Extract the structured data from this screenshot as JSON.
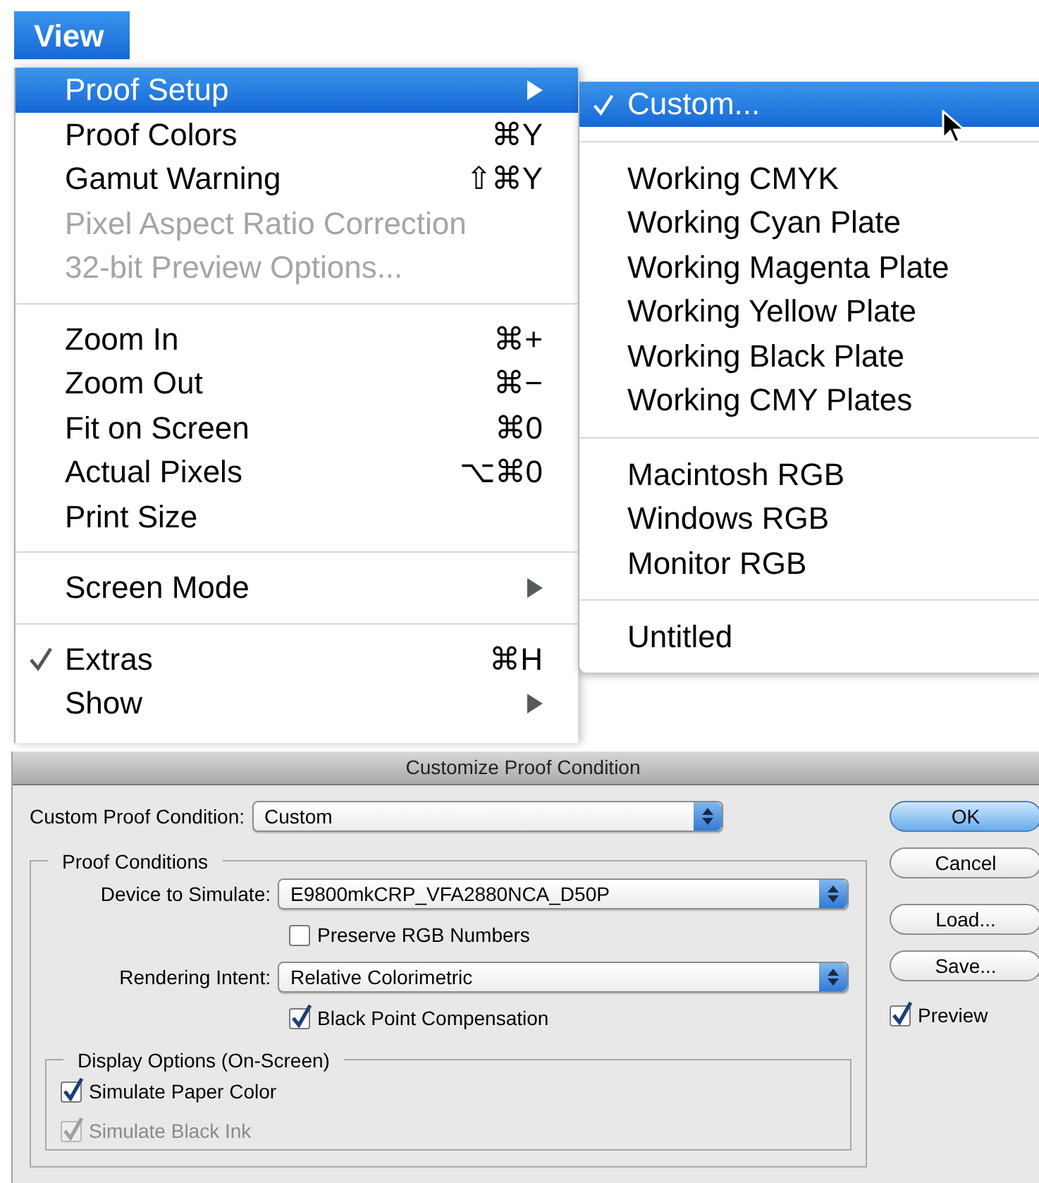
{
  "menu_bar": {
    "title": "View",
    "selected": true
  },
  "menu": {
    "groups": [
      [
        {
          "label": "Proof Setup",
          "submenu": true,
          "disabled": false,
          "checked": false,
          "selected": true
        },
        {
          "label": "Proof Colors",
          "shortcut": "⌘Y",
          "submenu": false,
          "disabled": false,
          "checked": false,
          "selected": false
        },
        {
          "label": "Gamut Warning",
          "shortcut": "⇧⌘Y",
          "submenu": false,
          "disabled": false,
          "checked": false,
          "selected": false
        },
        {
          "label": "Pixel Aspect Ratio Correction",
          "submenu": false,
          "disabled": true,
          "checked": false,
          "selected": false
        },
        {
          "label": "32-bit Preview Options...",
          "submenu": false,
          "disabled": true,
          "checked": false,
          "selected": false
        }
      ],
      [
        {
          "label": "Zoom In",
          "shortcut": "⌘+",
          "submenu": false,
          "disabled": false,
          "checked": false,
          "selected": false
        },
        {
          "label": "Zoom Out",
          "shortcut": "⌘−",
          "submenu": false,
          "disabled": false,
          "checked": false,
          "selected": false
        },
        {
          "label": "Fit on Screen",
          "shortcut": "⌘0",
          "submenu": false,
          "disabled": false,
          "checked": false,
          "selected": false
        },
        {
          "label": "Actual Pixels",
          "shortcut": "⌥⌘0",
          "submenu": false,
          "disabled": false,
          "checked": false,
          "selected": false
        },
        {
          "label": "Print Size",
          "submenu": false,
          "disabled": false,
          "checked": false,
          "selected": false
        }
      ],
      [
        {
          "label": "Screen Mode",
          "submenu": true,
          "disabled": false,
          "checked": false,
          "selected": false
        }
      ],
      [
        {
          "label": "Extras",
          "shortcut": "⌘H",
          "submenu": false,
          "disabled": false,
          "checked": true,
          "selected": false
        },
        {
          "label": "Show",
          "submenu": true,
          "disabled": false,
          "checked": false,
          "selected": false
        }
      ]
    ]
  },
  "submenu": {
    "groups": [
      [
        {
          "label": "Custom...",
          "checked": true,
          "selected": true
        }
      ],
      [
        {
          "label": "Working CMYK",
          "checked": false,
          "selected": false
        },
        {
          "label": "Working Cyan Plate",
          "checked": false,
          "selected": false
        },
        {
          "label": "Working Magenta Plate",
          "checked": false,
          "selected": false
        },
        {
          "label": "Working Yellow Plate",
          "checked": false,
          "selected": false
        },
        {
          "label": "Working Black Plate",
          "checked": false,
          "selected": false
        },
        {
          "label": "Working CMY Plates",
          "checked": false,
          "selected": false
        }
      ],
      [
        {
          "label": "Macintosh RGB",
          "checked": false,
          "selected": false
        },
        {
          "label": "Windows RGB",
          "checked": false,
          "selected": false
        },
        {
          "label": "Monitor RGB",
          "checked": false,
          "selected": false
        }
      ],
      [
        {
          "label": "Untitled",
          "checked": false,
          "selected": false
        }
      ]
    ]
  },
  "dialog": {
    "title": "Customize Proof Condition",
    "custom_condition": {
      "label": "Custom Proof Condition:",
      "value": "Custom"
    },
    "proof_conditions": {
      "legend": "Proof Conditions",
      "rows": [
        {
          "kind": "select",
          "label": "Device to Simulate:",
          "value": "E9800mkCRP_VFA2880NCA_D50P"
        },
        {
          "kind": "checkbox",
          "label": "Preserve RGB Numbers",
          "checked": false,
          "disabled": false
        },
        {
          "kind": "select",
          "label": "Rendering Intent:",
          "value": "Relative Colorimetric"
        },
        {
          "kind": "checkbox",
          "label": "Black Point Compensation",
          "checked": true,
          "disabled": false
        }
      ]
    },
    "display_options": {
      "legend": "Display Options (On-Screen)",
      "checkboxes": [
        {
          "label": "Simulate Paper Color",
          "checked": true,
          "disabled": false
        },
        {
          "label": "Simulate Black Ink",
          "checked": true,
          "disabled": true
        }
      ]
    },
    "buttons": [
      {
        "label": "OK",
        "default": true
      },
      {
        "label": "Cancel",
        "default": false
      },
      {
        "label": "Load...",
        "default": false
      },
      {
        "label": "Save...",
        "default": false
      }
    ],
    "preview": {
      "label": "Preview",
      "checked": true,
      "disabled": false
    }
  }
}
